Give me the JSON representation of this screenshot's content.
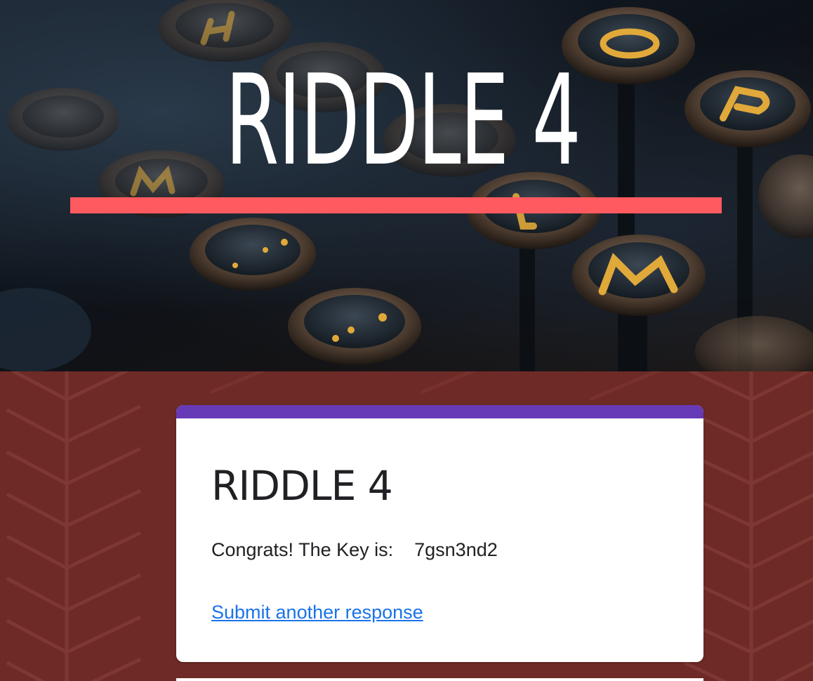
{
  "banner": {
    "title": "RIDDLE 4",
    "rule_color": "#ff5a5f",
    "background": "vintage typewriter keys photograph",
    "key_letters": [
      "H",
      "O",
      "P",
      "M",
      "L"
    ]
  },
  "form": {
    "accent_color": "#673ab7",
    "title": "RIDDLE 4",
    "confirmation_message": "Congrats! The Key is:    7gsn3nd2",
    "submit_another_label": "Submit another response",
    "link_color": "#1a73e8"
  },
  "page": {
    "background_color": "#6e2a26"
  }
}
